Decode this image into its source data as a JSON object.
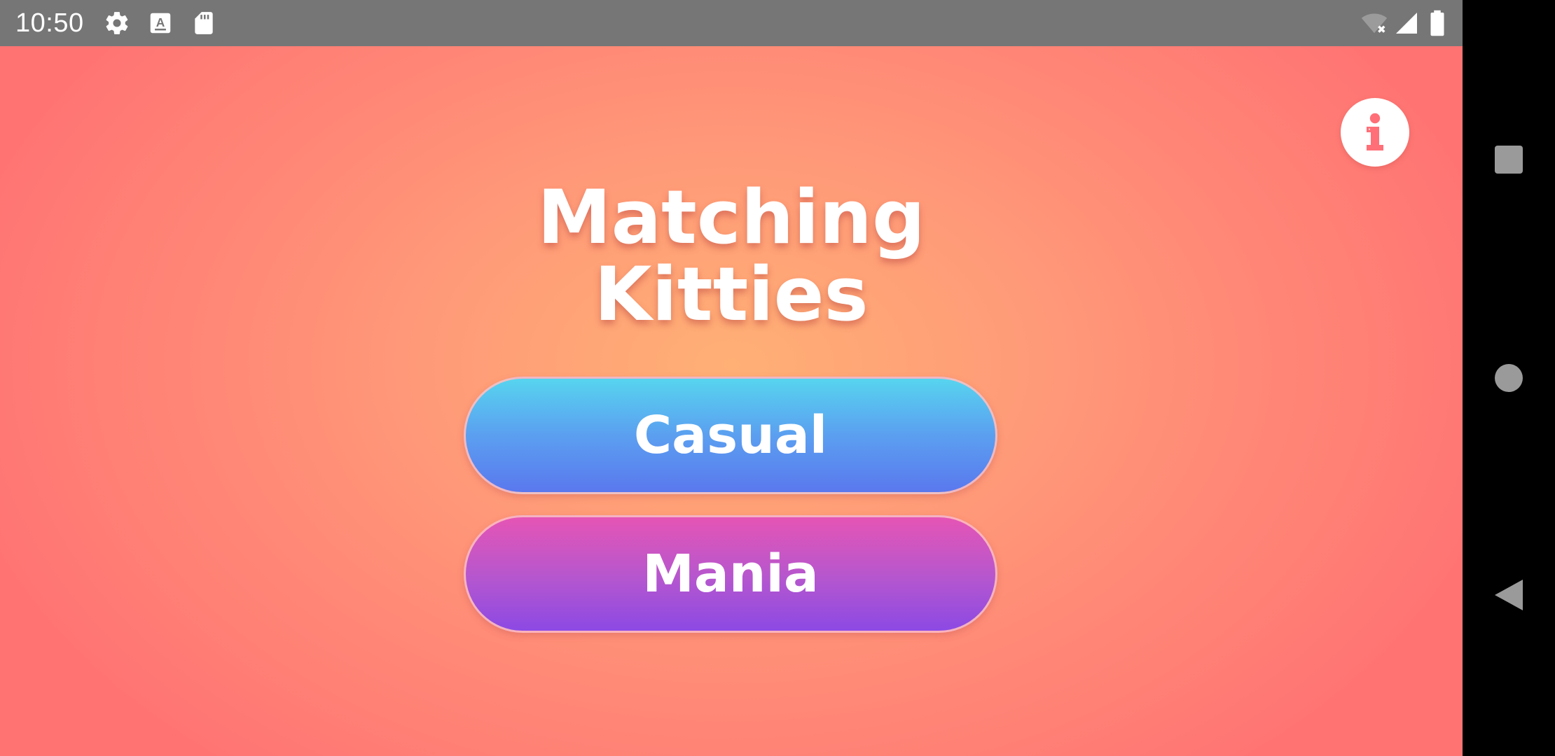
{
  "status_bar": {
    "time": "10:50",
    "left_icons": [
      "settings-icon",
      "keyboard-a-icon",
      "sd-card-icon"
    ],
    "right_icons": [
      "wifi-off-icon",
      "cell-signal-icon",
      "battery-icon"
    ]
  },
  "app": {
    "title_line1": "Matching",
    "title_line2": "Kitties",
    "info_icon": "info-icon",
    "buttons": {
      "casual": "Casual",
      "mania": "Mania"
    },
    "colors": {
      "background_center": "#ffb075",
      "background_edge": "#ff7373",
      "casual_top": "#57d4ef",
      "casual_bottom": "#5a78ee",
      "mania_top": "#e555b5",
      "mania_bottom": "#8c49e4",
      "info_accent": "#ff6f77"
    }
  },
  "nav_bar": {
    "buttons": [
      "recents-square-icon",
      "home-circle-icon",
      "back-triangle-icon"
    ]
  }
}
